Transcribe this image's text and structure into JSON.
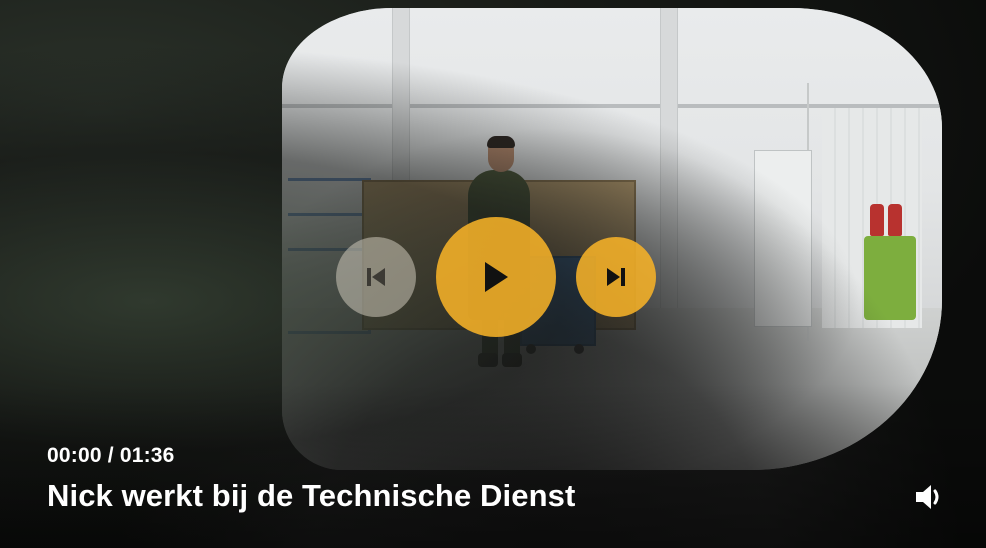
{
  "player": {
    "time": {
      "current": "00:00",
      "separator": " / ",
      "duration": "01:36"
    },
    "title": "Nick werkt bij de Technische Dienst",
    "controls": {
      "previous_icon": "skip-previous-icon",
      "play_icon": "play-icon",
      "next_icon": "skip-next-icon",
      "volume_icon": "volume-icon"
    },
    "colors": {
      "accent": "#F6B228",
      "text": "#FFFFFF"
    }
  }
}
